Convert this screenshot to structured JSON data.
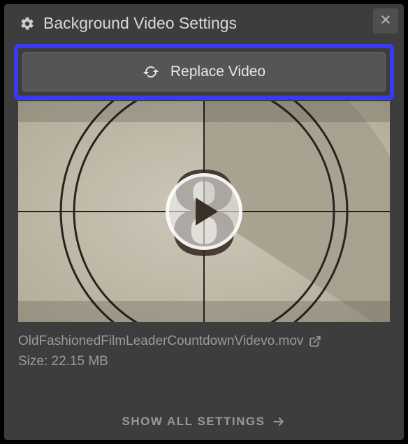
{
  "header": {
    "title": "Background Video Settings"
  },
  "replace": {
    "label": "Replace Video"
  },
  "meta": {
    "filename": "OldFashionedFilmLeaderCountdownVidevo.mov",
    "size_label": "Size: 22.15 MB"
  },
  "footer": {
    "show_all_label": "SHOW ALL SETTINGS"
  },
  "preview": {
    "countdown_number": "8"
  },
  "colors": {
    "highlight": "#3a3af5",
    "panel": "#3d3d3d",
    "button": "#555555"
  }
}
